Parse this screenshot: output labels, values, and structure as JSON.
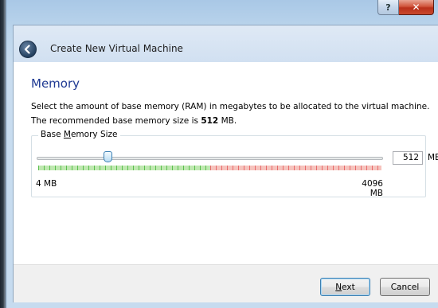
{
  "window": {
    "help_label": "?",
    "close_label": "✕",
    "title": "Create New Virtual Machine"
  },
  "page": {
    "title": "Memory",
    "description": "Select the amount of base memory (RAM) in megabytes to be allocated to the virtual machine.",
    "recommended_prefix": "The recommended base memory size is ",
    "recommended_value": "512",
    "recommended_suffix": " MB."
  },
  "memory": {
    "group_label_pre": "Base ",
    "group_label_mnemonic": "M",
    "group_label_post": "emory Size",
    "value": "512",
    "unit": "MB",
    "min_label": "4 MB",
    "max_label": "4096 MB",
    "slider_value_mb": 512,
    "slider_min_mb": 4,
    "slider_max_mb": 4096,
    "safe_fraction": 0.5
  },
  "buttons": {
    "next_mnemonic": "N",
    "next_rest": "ext",
    "cancel": "Cancel"
  },
  "colors": {
    "title_color": "#1f3a93",
    "safe_color": "#5bbf4e",
    "warning_color": "#e66b6b",
    "accent": "#3c7fb1"
  }
}
